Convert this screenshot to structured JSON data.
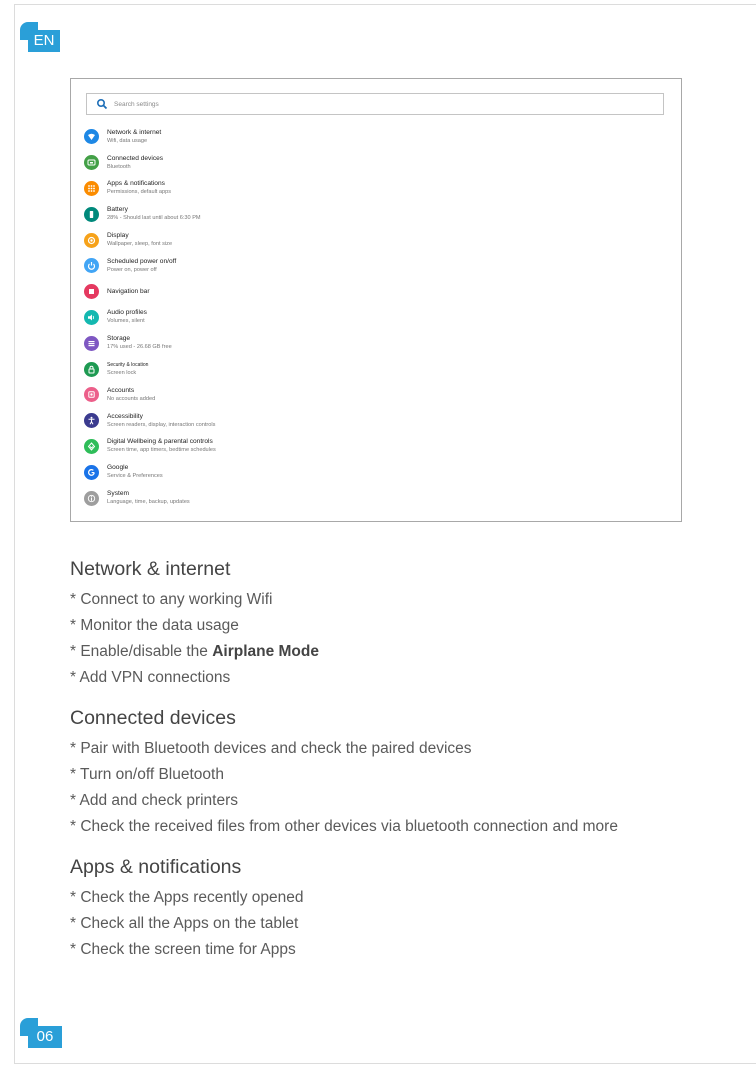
{
  "lang_tab": "EN",
  "page_number": "06",
  "screenshot": {
    "search_placeholder": "Search settings",
    "items": [
      {
        "title": "Network & internet",
        "subtitle": "Wifi, data usage",
        "icon": "wifi-icon",
        "color": "#1e88e5"
      },
      {
        "title": "Connected devices",
        "subtitle": "Bluetooth",
        "icon": "devices-icon",
        "color": "#43a047"
      },
      {
        "title": "Apps & notifications",
        "subtitle": "Permissions, default apps",
        "icon": "apps-icon",
        "color": "#fb8c00"
      },
      {
        "title": "Battery",
        "subtitle": "28% - Should last until about 6:30 PM",
        "icon": "battery-icon",
        "color": "#00897b"
      },
      {
        "title": "Display",
        "subtitle": "Wallpaper, sleep, font size",
        "icon": "display-icon",
        "color": "#f6a21a"
      },
      {
        "title": "Scheduled power on/off",
        "subtitle": "Power on, power off",
        "icon": "power-icon",
        "color": "#42a5f5"
      },
      {
        "title": "Navigation bar",
        "subtitle": "",
        "icon": "navigation-icon",
        "color": "#e53960"
      },
      {
        "title": "Audio profiles",
        "subtitle": "Volumes, silent",
        "icon": "volume-icon",
        "color": "#14b8b0"
      },
      {
        "title": "Storage",
        "subtitle": "17% used - 26.68 GB free",
        "icon": "storage-icon",
        "color": "#7e57c2"
      },
      {
        "title": "Security & location",
        "subtitle": "Screen lock",
        "icon": "lock-icon",
        "color": "#1e9a52"
      },
      {
        "title": "Accounts",
        "subtitle": "No accounts added",
        "icon": "account-icon",
        "color": "#ec5f8a"
      },
      {
        "title": "Accessibility",
        "subtitle": "Screen readers, display, interaction controls",
        "icon": "accessibility-icon",
        "color": "#3b3b8f"
      },
      {
        "title": "Digital Wellbeing & parental controls",
        "subtitle": "Screen time, app timers, bedtime schedules",
        "icon": "wellbeing-icon",
        "color": "#2ebd59"
      },
      {
        "title": "Google",
        "subtitle": "Service & Preferences",
        "icon": "google-icon",
        "color": "#1a73e8"
      },
      {
        "title": "System",
        "subtitle": "Language, time, backup, updates",
        "icon": "info-icon",
        "color": "#9e9e9e"
      }
    ]
  },
  "sections": [
    {
      "heading": "Network & internet",
      "bullets": [
        {
          "text": "* Connect to any working Wifi"
        },
        {
          "text": "* Monitor the data usage"
        },
        {
          "prefix": "* Enable/disable the ",
          "bold": "Airplane Mode"
        },
        {
          "text": "* Add VPN connections"
        }
      ]
    },
    {
      "heading": "Connected devices",
      "bullets": [
        {
          "text": "* Pair with Bluetooth devices and check the paired devices"
        },
        {
          "text": "* Turn on/off Bluetooth"
        },
        {
          "text": "* Add and check printers"
        },
        {
          "text": "* Check the received files from other devices via bluetooth connection and more"
        }
      ]
    },
    {
      "heading": "Apps & notifications",
      "bullets": [
        {
          "text": "* Check the Apps recently opened"
        },
        {
          "text": "* Check all the Apps on the tablet"
        },
        {
          "text": "* Check the screen time for Apps"
        }
      ]
    }
  ]
}
